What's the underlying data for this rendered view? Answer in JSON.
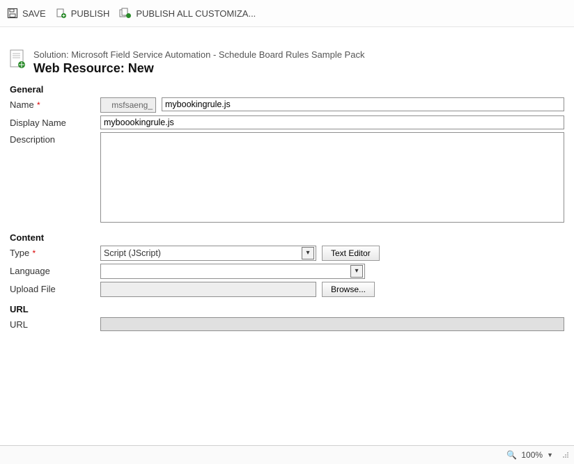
{
  "toolbar": {
    "save": "SAVE",
    "publish": "PUBLISH",
    "publish_all": "PUBLISH ALL CUSTOMIZA..."
  },
  "header": {
    "solution_line": "Solution: Microsoft Field Service Automation - Schedule Board Rules Sample Pack",
    "title": "Web Resource: New"
  },
  "general": {
    "section": "General",
    "name_label": "Name",
    "prefix": "msfsaeng_",
    "name_value": "mybookingrule.js",
    "display_name_label": "Display Name",
    "display_name_value": "myboookingrule.js",
    "description_label": "Description",
    "description_value": ""
  },
  "content": {
    "section": "Content",
    "type_label": "Type",
    "type_value": "Script (JScript)",
    "text_editor_btn": "Text Editor",
    "language_label": "Language",
    "language_value": "",
    "upload_label": "Upload File",
    "upload_path": "",
    "browse_btn": "Browse..."
  },
  "url": {
    "section": "URL",
    "url_label": "URL",
    "url_value": ""
  },
  "status": {
    "zoom": "100%"
  }
}
